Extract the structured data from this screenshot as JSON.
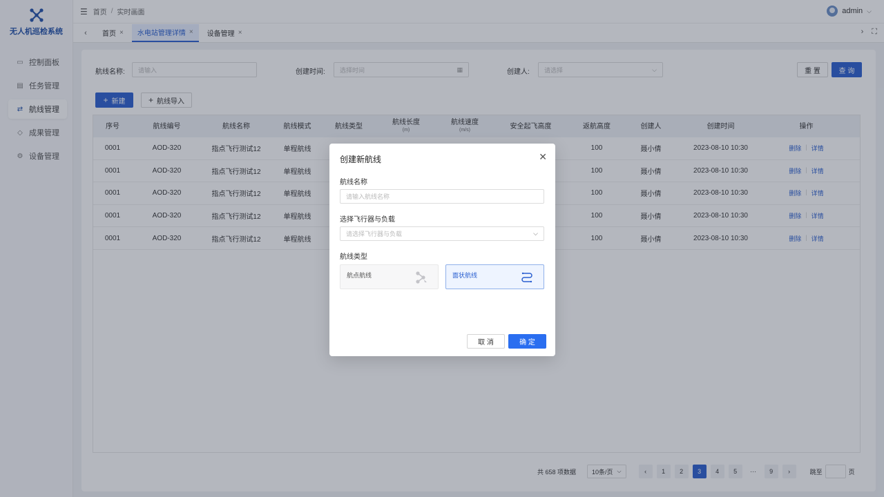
{
  "app": {
    "title": "无人机巡检系统"
  },
  "sidebar": {
    "items": [
      {
        "label": "控制面板",
        "icon": "monitor-icon",
        "active": false
      },
      {
        "label": "任务管理",
        "icon": "clipboard-icon",
        "active": false
      },
      {
        "label": "航线管理",
        "icon": "route-icon",
        "active": true
      },
      {
        "label": "成果管理",
        "icon": "shield-icon",
        "active": false
      },
      {
        "label": "设备管理",
        "icon": "gear-icon",
        "active": false
      }
    ]
  },
  "header": {
    "breadcrumb": [
      "首页",
      "实时画面"
    ],
    "user": "admin"
  },
  "tabs": [
    {
      "label": "首页",
      "active": false
    },
    {
      "label": "水电站管理详情",
      "active": true
    },
    {
      "label": "设备管理",
      "active": false
    }
  ],
  "filters": {
    "route_name_label": "航线名称:",
    "route_name_placeholder": "请输入",
    "created_time_label": "创建时间:",
    "created_time_placeholder": "选择时间",
    "creator_label": "创建人:",
    "creator_placeholder": "请选择",
    "reset_label": "重 置",
    "query_label": "查 询"
  },
  "toolbar": {
    "new_label": "新建",
    "import_label": "航线导入"
  },
  "table": {
    "columns": [
      {
        "label": "序号",
        "sub": ""
      },
      {
        "label": "航线编号",
        "sub": ""
      },
      {
        "label": "航线名称",
        "sub": ""
      },
      {
        "label": "航线模式",
        "sub": ""
      },
      {
        "label": "航线类型",
        "sub": ""
      },
      {
        "label": "航线长度",
        "sub": "(m)"
      },
      {
        "label": "航线速度",
        "sub": "(m/s)"
      },
      {
        "label": "安全起飞高度",
        "sub": ""
      },
      {
        "label": "返航高度",
        "sub": ""
      },
      {
        "label": "创建人",
        "sub": ""
      },
      {
        "label": "创建时间",
        "sub": ""
      },
      {
        "label": "操作",
        "sub": ""
      }
    ],
    "rows": [
      {
        "no": "0001",
        "code": "AOD-320",
        "name": "指点飞行测试12",
        "mode": "单程航线",
        "type": "",
        "length": "",
        "speed": "",
        "safe_height": "",
        "return_height": "100",
        "creator": "聂小倩",
        "created": "2023-08-10 10:30"
      },
      {
        "no": "0001",
        "code": "AOD-320",
        "name": "指点飞行测试12",
        "mode": "单程航线",
        "type": "",
        "length": "",
        "speed": "",
        "safe_height": "",
        "return_height": "100",
        "creator": "聂小倩",
        "created": "2023-08-10 10:30"
      },
      {
        "no": "0001",
        "code": "AOD-320",
        "name": "指点飞行测试12",
        "mode": "单程航线",
        "type": "",
        "length": "",
        "speed": "",
        "safe_height": "",
        "return_height": "100",
        "creator": "聂小倩",
        "created": "2023-08-10 10:30"
      },
      {
        "no": "0001",
        "code": "AOD-320",
        "name": "指点飞行测试12",
        "mode": "单程航线",
        "type": "",
        "length": "",
        "speed": "",
        "safe_height": "",
        "return_height": "100",
        "creator": "聂小倩",
        "created": "2023-08-10 10:30"
      },
      {
        "no": "0001",
        "code": "AOD-320",
        "name": "指点飞行测试12",
        "mode": "单程航线",
        "type": "",
        "length": "",
        "speed": "",
        "safe_height": "",
        "return_height": "100",
        "creator": "聂小倩",
        "created": "2023-08-10 10:30"
      }
    ],
    "actions": {
      "delete": "删除",
      "detail": "详情"
    }
  },
  "pagination": {
    "total": "共 658 项数据",
    "page_size": "10条/页",
    "pages": [
      "1",
      "2",
      "3",
      "4",
      "5",
      "···",
      "9"
    ],
    "current": "3",
    "jump_label": "跳至",
    "jump_suffix": "页"
  },
  "modal": {
    "title": "创建新航线",
    "name_label": "航线名称",
    "name_placeholder": "请输入航线名称",
    "aircraft_label": "选择飞行器与负载",
    "aircraft_placeholder": "请选择飞行器与负载",
    "type_label": "航线类型",
    "types": [
      {
        "label": "航点航线",
        "selected": false
      },
      {
        "label": "面状航线",
        "selected": true
      }
    ],
    "cancel_label": "取 消",
    "confirm_label": "确 定"
  },
  "colors": {
    "primary": "#2a5fd0",
    "brand": "#1f4fa8"
  }
}
